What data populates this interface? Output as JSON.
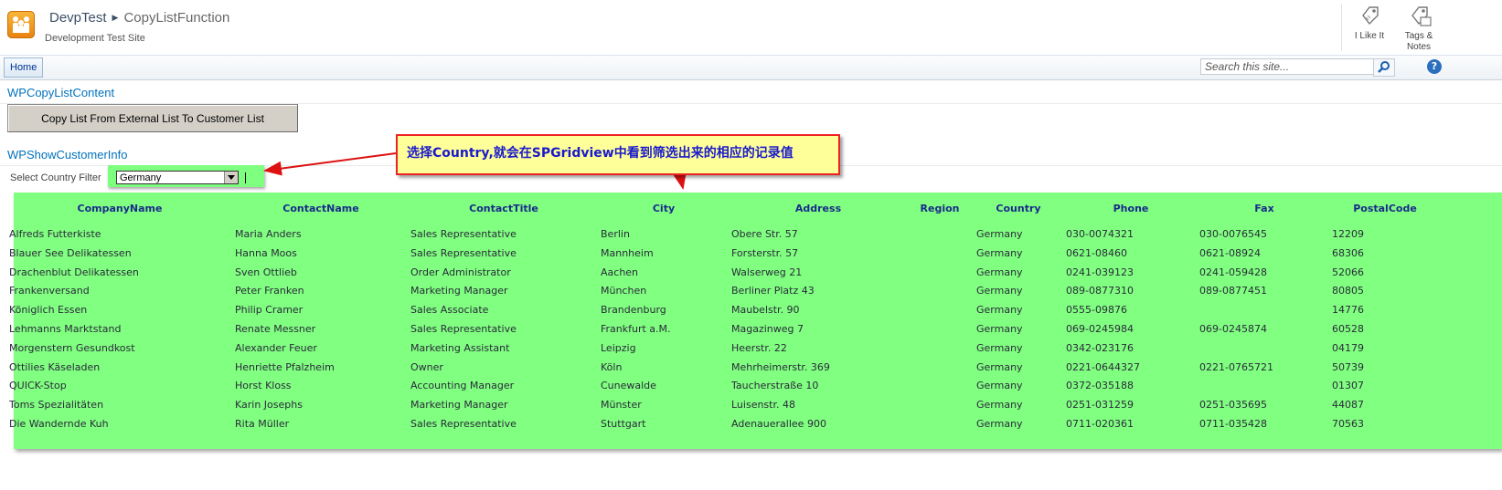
{
  "header": {
    "site_name": "DevpTest",
    "page_name": "CopyListFunction",
    "description": "Development Test Site",
    "like_label": "I Like It",
    "tags_label_1": "Tags &",
    "tags_label_2": "Notes"
  },
  "nav": {
    "home_label": "Home",
    "search_placeholder": "Search this site..."
  },
  "webparts": {
    "copy_title": "WPCopyListContent",
    "copy_button": "Copy List From External List To Customer List",
    "show_title": "WPShowCustomerInfo",
    "filter_label": "Select Country Filter",
    "filter_value": "Germany"
  },
  "annotation": {
    "text": "选择Country,就会在SPGridview中看到筛选出来的相应的记录值",
    "border_color": "#ee2222",
    "background": "#ffff99"
  },
  "grid": {
    "background": "#80ff80",
    "columns": [
      "CompanyName",
      "ContactName",
      "ContactTitle",
      "City",
      "Address",
      "Region",
      "Country",
      "Phone",
      "Fax",
      "PostalCode"
    ],
    "rows": [
      [
        "Alfreds Futterkiste",
        "Maria Anders",
        "Sales Representative",
        "Berlin",
        "Obere Str. 57",
        "",
        "Germany",
        "030-0074321",
        "030-0076545",
        "12209"
      ],
      [
        "Blauer See Delikatessen",
        "Hanna Moos",
        "Sales Representative",
        "Mannheim",
        "Forsterstr. 57",
        "",
        "Germany",
        "0621-08460",
        "0621-08924",
        "68306"
      ],
      [
        "Drachenblut Delikatessen",
        "Sven Ottlieb",
        "Order Administrator",
        "Aachen",
        "Walserweg 21",
        "",
        "Germany",
        "0241-039123",
        "0241-059428",
        "52066"
      ],
      [
        "Frankenversand",
        "Peter Franken",
        "Marketing Manager",
        "München",
        "Berliner Platz 43",
        "",
        "Germany",
        "089-0877310",
        "089-0877451",
        "80805"
      ],
      [
        "Königlich Essen",
        "Philip Cramer",
        "Sales Associate",
        "Brandenburg",
        "Maubelstr. 90",
        "",
        "Germany",
        "0555-09876",
        "",
        "14776"
      ],
      [
        "Lehmanns Marktstand",
        "Renate Messner",
        "Sales Representative",
        "Frankfurt a.M.",
        "Magazinweg 7",
        "",
        "Germany",
        "069-0245984",
        "069-0245874",
        "60528"
      ],
      [
        "Morgenstern Gesundkost",
        "Alexander Feuer",
        "Marketing Assistant",
        "Leipzig",
        "Heerstr. 22",
        "",
        "Germany",
        "0342-023176",
        "",
        "04179"
      ],
      [
        "Ottilies Käseladen",
        "Henriette Pfalzheim",
        "Owner",
        "Köln",
        "Mehrheimerstr. 369",
        "",
        "Germany",
        "0221-0644327",
        "0221-0765721",
        "50739"
      ],
      [
        "QUICK-Stop",
        "Horst Kloss",
        "Accounting Manager",
        "Cunewalde",
        "Taucherstraße 10",
        "",
        "Germany",
        "0372-035188",
        "",
        "01307"
      ],
      [
        "Toms Spezialitäten",
        "Karin Josephs",
        "Marketing Manager",
        "Münster",
        "Luisenstr. 48",
        "",
        "Germany",
        "0251-031259",
        "0251-035695",
        "44087"
      ],
      [
        "Die Wandernde Kuh",
        "Rita Müller",
        "Sales Representative",
        "Stuttgart",
        "Adenauerallee 900",
        "",
        "Germany",
        "0711-020361",
        "0711-035428",
        "70563"
      ]
    ]
  }
}
